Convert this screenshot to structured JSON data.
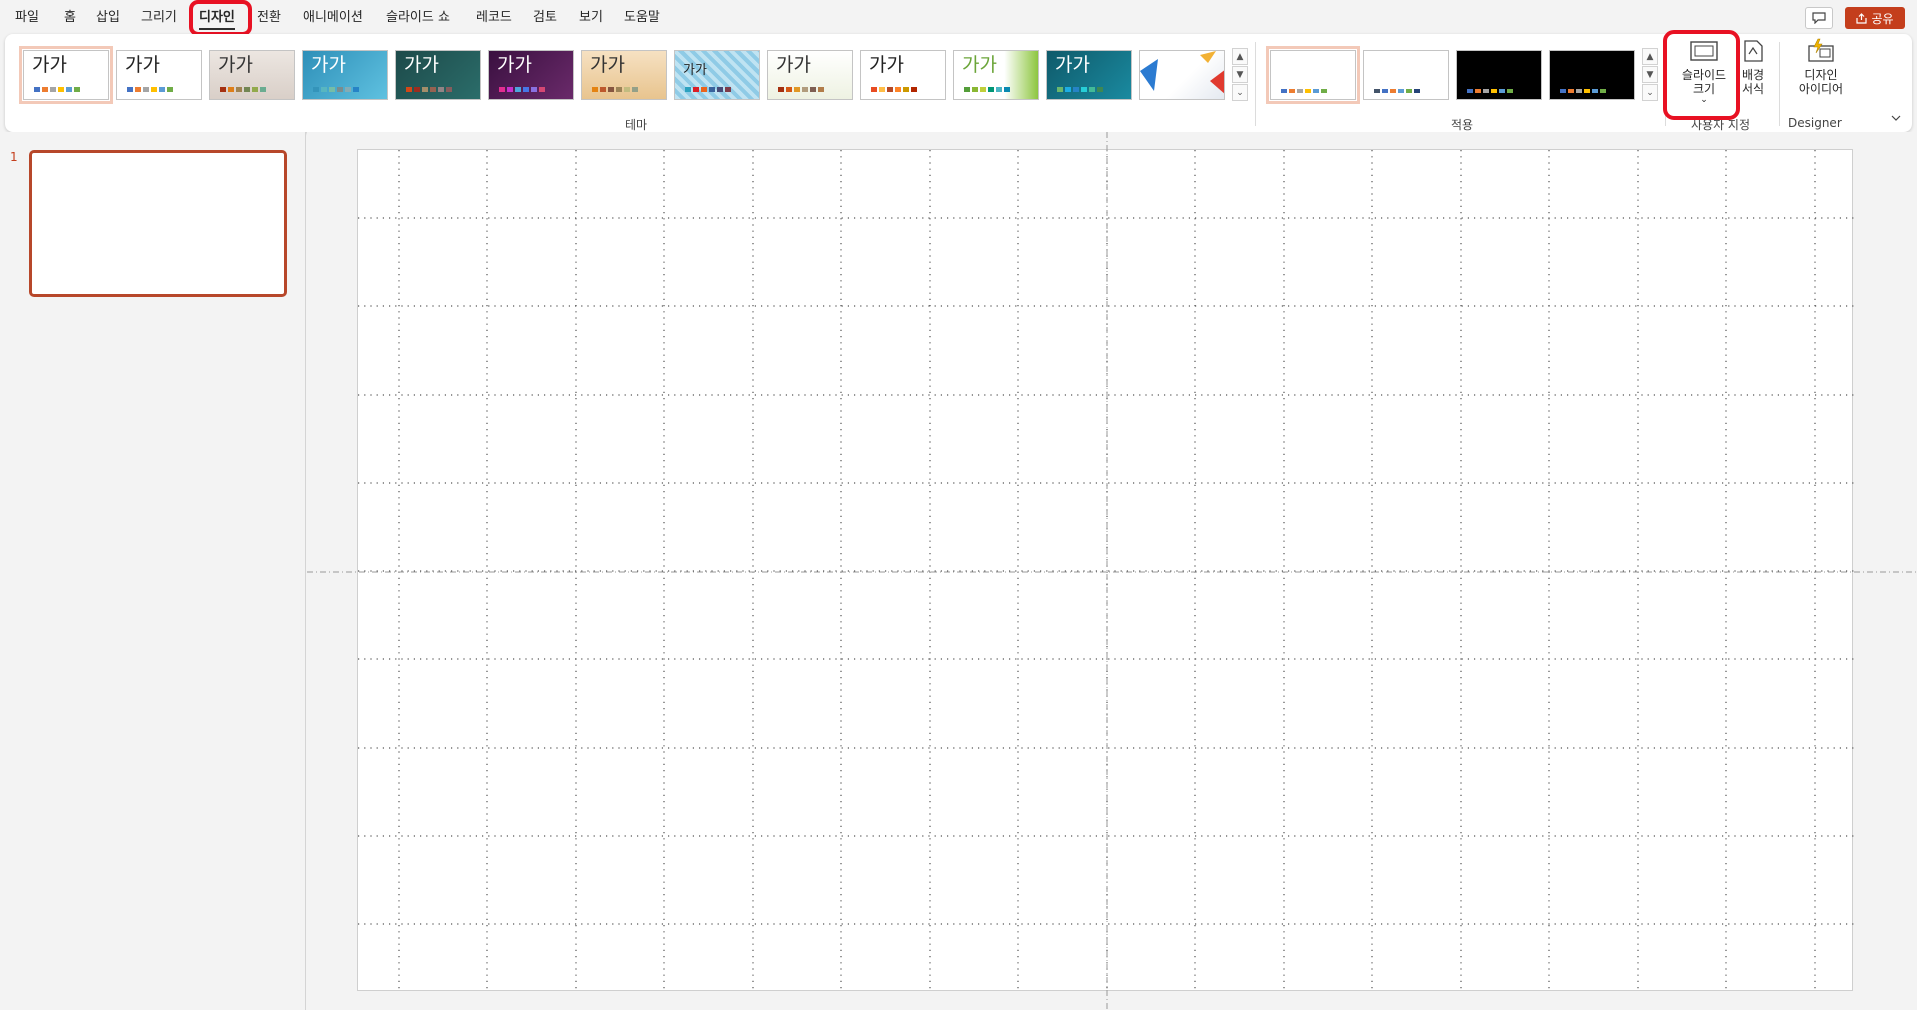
{
  "menu": {
    "tabs": [
      "파일",
      "홈",
      "삽입",
      "그리기",
      "디자인",
      "전환",
      "애니메이션",
      "슬라이드 쇼",
      "레코드",
      "검토",
      "보기",
      "도움말"
    ],
    "active_tab": "디자인",
    "share_label": "공유"
  },
  "ribbon": {
    "themes_group_label": "테마",
    "variants_group_label": "적용",
    "customize_group_label": "사용자 지정",
    "designer_group_label": "Designer",
    "theme_thumbnail_text": "가가",
    "slide_size_label": "슬라이드\n크기",
    "format_background_label": "배경\n서식",
    "design_ideas_label": "디자인\n아이디어"
  },
  "slides": {
    "current_number": "1"
  },
  "colors": {
    "accent": "#c43e1c",
    "highlight_box": "#e81123"
  },
  "icons": [
    "comment-icon",
    "share-icon",
    "slide-size-icon",
    "format-background-icon",
    "design-ideas-icon",
    "chevron-down-icon",
    "collapse-ribbon-icon"
  ]
}
